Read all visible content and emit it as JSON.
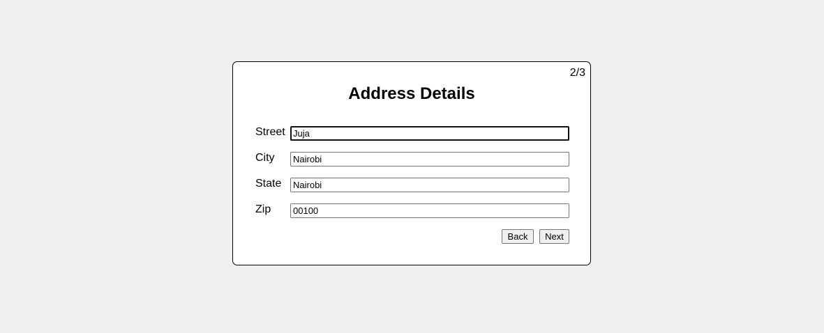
{
  "form": {
    "step_indicator": "2/3",
    "title": "Address Details",
    "fields": [
      {
        "label": "Street",
        "value": "Juja"
      },
      {
        "label": "City",
        "value": "Nairobi"
      },
      {
        "label": "State",
        "value": "Nairobi"
      },
      {
        "label": "Zip",
        "value": "00100"
      }
    ],
    "back_label": "Back",
    "next_label": "Next"
  }
}
